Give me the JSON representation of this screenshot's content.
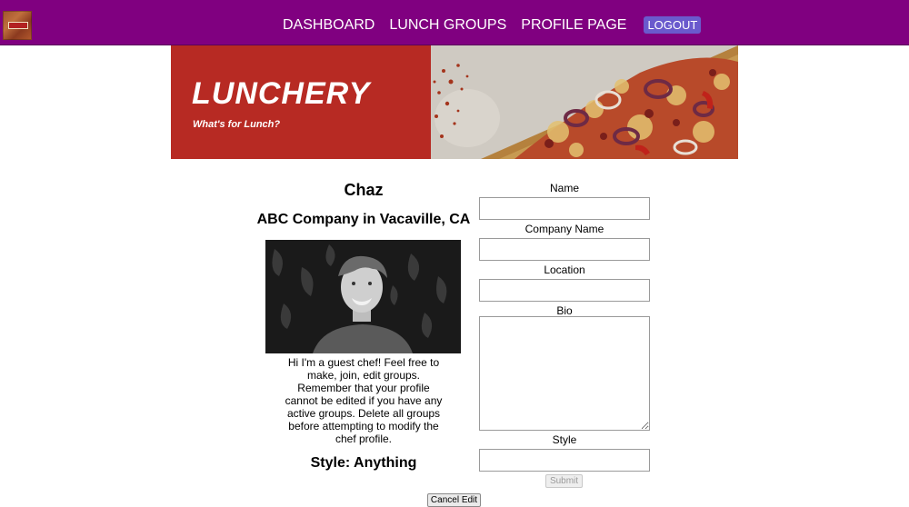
{
  "nav": {
    "links": [
      "DASHBOARD",
      "LUNCH GROUPS",
      "PROFILE PAGE"
    ],
    "logout_label": "LOGOUT"
  },
  "banner": {
    "title": "LUNCHERY",
    "subtitle": "What's for Lunch?"
  },
  "profile": {
    "name": "Chaz",
    "company_location": "ABC Company in Vacaville, CA",
    "bio": "Hi I'm a guest chef! Feel free to make, join, edit groups. Remember that your profile cannot be edited if you have any active groups. Delete all groups before attempting to modify the chef profile.",
    "style_line": "Style: Anything"
  },
  "form": {
    "name_label": "Name",
    "name_value": "",
    "company_label": "Company Name",
    "company_value": "",
    "location_label": "Location",
    "location_value": "",
    "bio_label": "Bio",
    "bio_value": "",
    "style_label": "Style",
    "style_value": "",
    "submit_label": "Submit",
    "cancel_label": "Cancel Edit"
  },
  "colors": {
    "navbar": "#800080",
    "logout_button": "#6a5acd",
    "banner_red": "#b72a23"
  }
}
